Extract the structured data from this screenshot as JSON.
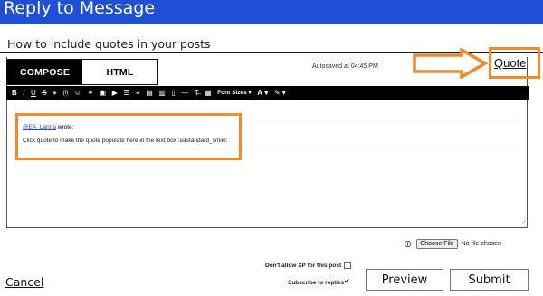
{
  "header": {
    "title": "Reply to Message"
  },
  "subject": {
    "text": "How to include quotes in your posts"
  },
  "editor": {
    "tabs": [
      {
        "label": "COMPOSE",
        "active": true
      },
      {
        "label": "HTML",
        "active": false
      }
    ],
    "autosave": "Autosaved at 04:45 PM",
    "quote_link": "Quote",
    "toolbar": {
      "bold": "B",
      "italic": "I",
      "underline": "U",
      "strike": "S",
      "font_sizes": "Font Sizes",
      "font_color": "A"
    },
    "content": {
      "mention": "@EA_Lanna",
      "wrote": " wrote:",
      "quote_text": "Click quote to make the quote populate here in the text box :eastandard_smile:"
    }
  },
  "attachment": {
    "button_label": "Choose File",
    "status": "No file chosen"
  },
  "options": {
    "xp_label": "Don't allow XP for this post",
    "subscribe_label": "Subscribe to replies"
  },
  "actions": {
    "cancel": "Cancel",
    "preview": "Preview",
    "submit": "Submit"
  },
  "colors": {
    "header_bg": "#1f4fd4",
    "highlight": "#f08a2a",
    "toolbar_bg": "#000000"
  }
}
